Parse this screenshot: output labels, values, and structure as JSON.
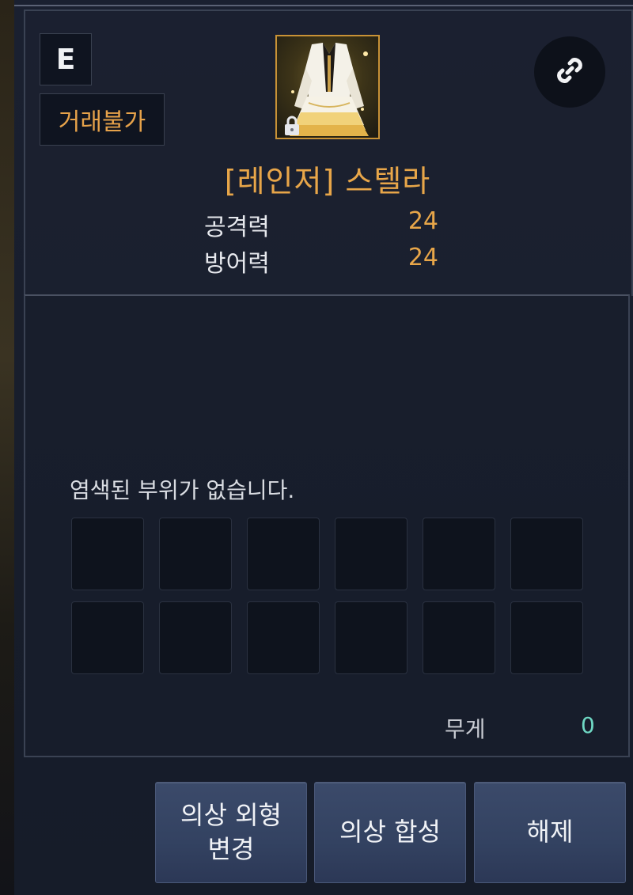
{
  "item": {
    "grade": "E",
    "trade_status": "거래불가",
    "name": "[레인저] 스텔라",
    "stats": [
      {
        "label": "공격력",
        "value": "24"
      },
      {
        "label": "방어력",
        "value": "24"
      }
    ],
    "icon": "costume-dress-icon",
    "lock_icon": "lock-icon"
  },
  "link_button": {
    "icon": "link-icon"
  },
  "dye": {
    "message": "염색된 부위가 없습니다.",
    "slot_count": 12
  },
  "weight": {
    "label": "무게",
    "value": "0"
  },
  "buttons": {
    "change_appearance_line1": "의상 외형",
    "change_appearance_line2": "변경",
    "synthesize": "의상 합성",
    "unequip": "해제"
  },
  "colors": {
    "accent_gold": "#e8a649",
    "weight_teal": "#6fd8c4",
    "button_blue": "#344362"
  }
}
